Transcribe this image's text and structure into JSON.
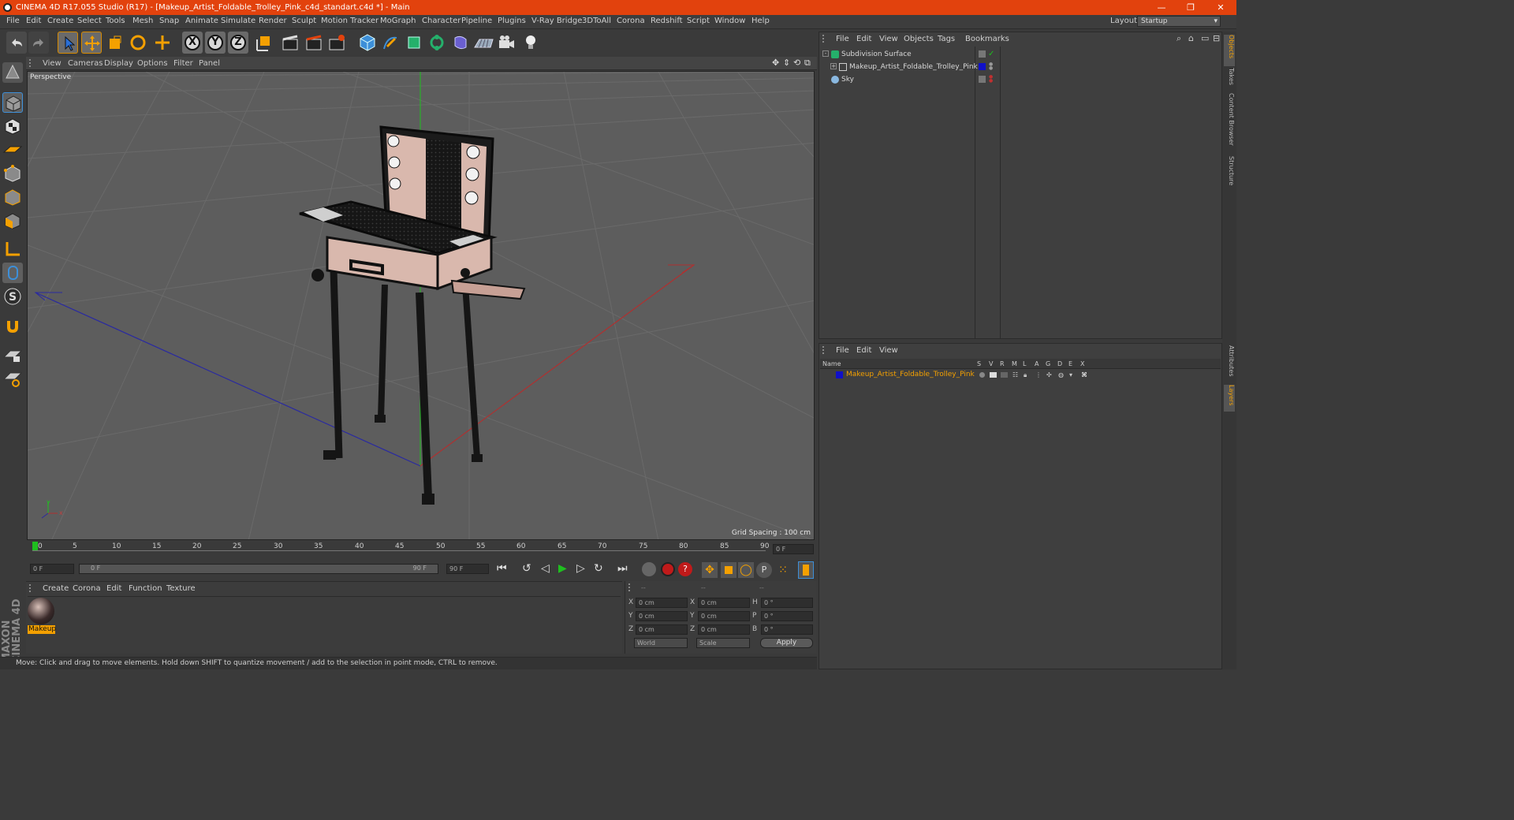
{
  "window": {
    "title": "CINEMA 4D R17.055 Studio (R17) - [Makeup_Artist_Foldable_Trolley_Pink_c4d_standart.c4d *] - Main",
    "minimize": "—",
    "restore": "❐",
    "close": "✕"
  },
  "menu": [
    "File",
    "Edit",
    "Create",
    "Select",
    "Tools",
    "Mesh",
    "Snap",
    "Animate",
    "Simulate",
    "Render",
    "Sculpt",
    "Motion Tracker",
    "MoGraph",
    "Character",
    "Pipeline",
    "Plugins",
    "V-Ray Bridge",
    "3DToAll",
    "Corona",
    "Redshift",
    "Script",
    "Window",
    "Help"
  ],
  "layout": {
    "label": "Layout:",
    "value": "Startup"
  },
  "toolbar": {
    "x": "X",
    "y": "Y",
    "z": "Z"
  },
  "viewport_menu": [
    "View",
    "Cameras",
    "Display",
    "Options",
    "Filter",
    "Panel"
  ],
  "viewport": {
    "label": "Perspective",
    "grid_spacing": "Grid Spacing : 100 cm",
    "axis_x": "x",
    "axis_y": "y"
  },
  "timeline": {
    "ticks": [
      "0",
      "5",
      "10",
      "15",
      "20",
      "25",
      "30",
      "35",
      "40",
      "45",
      "50",
      "55",
      "60",
      "65",
      "70",
      "75",
      "80",
      "85",
      "90"
    ],
    "current_frame": "0 F"
  },
  "playback": {
    "start": "0 F",
    "range_start": "0 F",
    "range_end": "90 F",
    "end": "90 F"
  },
  "material_menu": [
    "Create",
    "Corona",
    "Edit",
    "Function",
    "Texture"
  ],
  "material": {
    "name": "Makeup"
  },
  "coords": {
    "head": [
      "--",
      "--",
      "--"
    ],
    "rows": [
      {
        "a": "X",
        "v1": "0 cm",
        "b": "X",
        "v2": "0 cm",
        "c": "H",
        "v3": "0 °"
      },
      {
        "a": "Y",
        "v1": "0 cm",
        "b": "Y",
        "v2": "0 cm",
        "c": "P",
        "v3": "0 °"
      },
      {
        "a": "Z",
        "v1": "0 cm",
        "b": "Z",
        "v2": "0 cm",
        "c": "B",
        "v3": "0 °"
      }
    ],
    "world": "World",
    "scale": "Scale",
    "apply": "Apply"
  },
  "status": "Move: Click and drag to move elements. Hold down SHIFT to quantize movement / add to the selection in point mode, CTRL to remove.",
  "object_menu": [
    "File",
    "Edit",
    "View",
    "Objects",
    "Tags",
    "Bookmarks"
  ],
  "objects": [
    "Subdivision Surface",
    "Makeup_Artist_Foldable_Trolley_Pink",
    "Sky"
  ],
  "layer_menu": [
    "File",
    "Edit",
    "View"
  ],
  "layer_header": {
    "name": "Name",
    "cols": [
      "S",
      "V",
      "R",
      "M",
      "L",
      "A",
      "G",
      "D",
      "E",
      "X"
    ]
  },
  "layer_item": "Makeup_Artist_Foldable_Trolley_Pink",
  "side_tabs": [
    "Objects",
    "Takes",
    "Content Browser",
    "Structure",
    "Attributes",
    "Layers"
  ],
  "brand": "MAXON CINEMA 4D",
  "colors": {
    "title_bar": "#e2420d",
    "accent": "#f4a000",
    "layer_blue": "#1010c8"
  }
}
